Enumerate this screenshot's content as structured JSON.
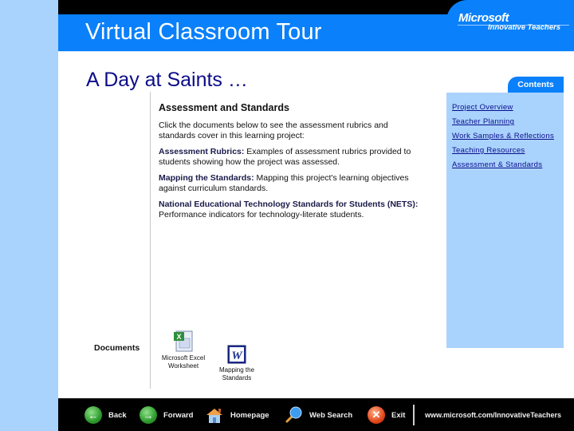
{
  "header": {
    "title": "Virtual Classroom Tour",
    "logo_brand": "Microsoft",
    "logo_sub": "Innovative Teachers"
  },
  "page": {
    "title": "A Day at Saints …"
  },
  "main": {
    "section_title": "Assessment and Standards",
    "intro": "Click the documents below to see the assessment rubrics and standards cover in this learning project:",
    "items": [
      {
        "label": "Assessment Rubrics:",
        "text": " Examples of assessment rubrics provided to students showing how the project was assessed."
      },
      {
        "label": "Mapping the Standards:",
        "text": " Mapping this project's learning objectives against curriculum standards."
      },
      {
        "label": "National Educational Technology Standards for Students (NETS):",
        "text": " Performance indicators for technology-literate students."
      }
    ]
  },
  "documents": {
    "label": "Documents",
    "files": [
      {
        "icon": "excel-icon",
        "line1": "Microsoft Excel",
        "line2": "Worksheet"
      },
      {
        "icon": "word-icon",
        "line1": "Mapping the",
        "line2": "Standards"
      }
    ]
  },
  "contents": {
    "tab_label": "Contents",
    "links": [
      "Project Overview",
      "Teacher Planning",
      "Work Samples & Reflections",
      "Teaching Resources",
      "Assessment & Standards"
    ]
  },
  "footer": {
    "back": "Back",
    "forward": "Forward",
    "homepage": "Homepage",
    "web_search": "Web Search",
    "exit": "Exit",
    "url": "www.microsoft.com/InnovativeTeachers"
  }
}
